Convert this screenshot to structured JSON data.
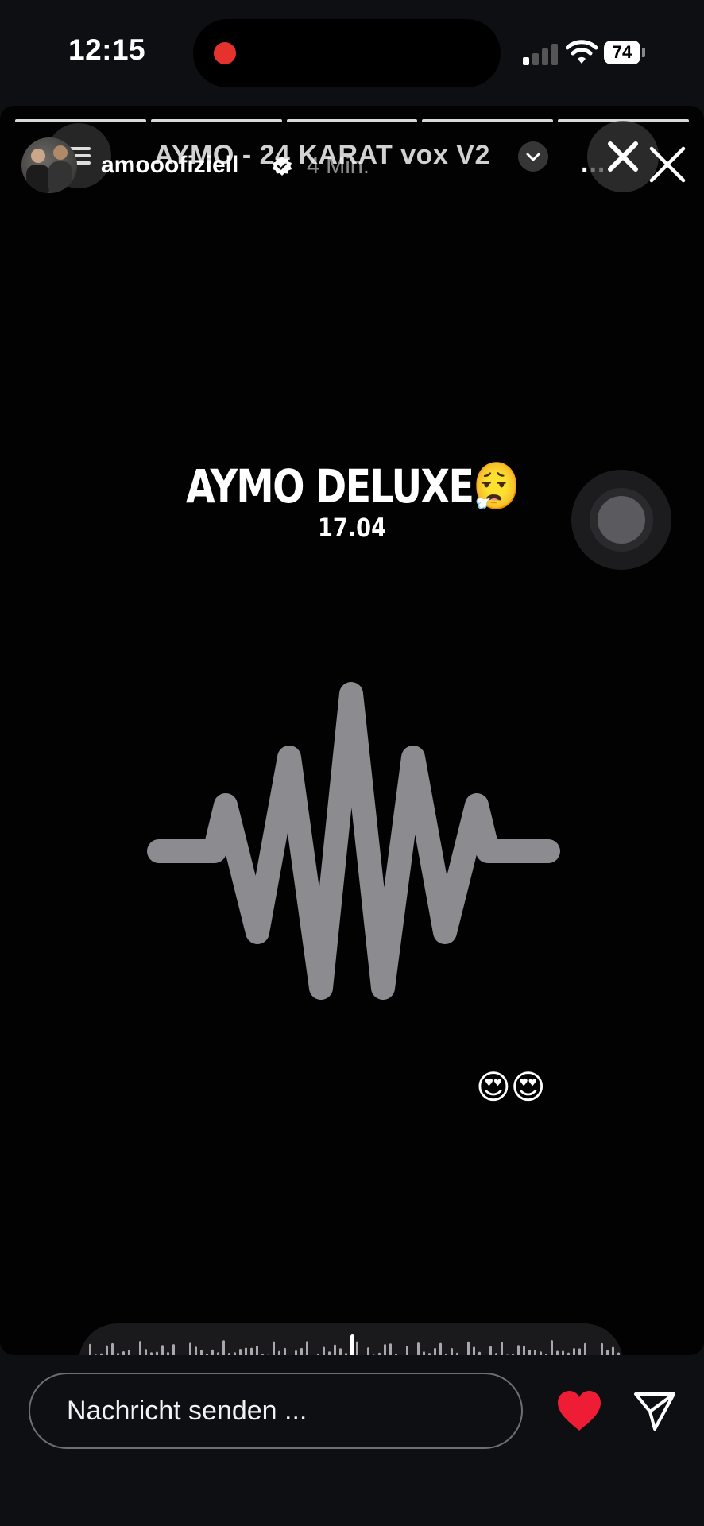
{
  "status_bar": {
    "time": "12:15",
    "battery": "74",
    "recording_color": "#e5322d",
    "signal_bars_active": 1,
    "signal_bars_total": 4
  },
  "story": {
    "segments": 5,
    "username": "amooofiziell",
    "verified": true,
    "time_ago": "4 Min.",
    "song_title": "AYMO - 24 KARAT vox V2",
    "more_label": "...",
    "headline": "AYMO DELUXE😮‍💨",
    "date": "17.04",
    "emojis": "😍😍",
    "icons": [
      "menu-icon",
      "verified-icon",
      "chevron-down-icon",
      "close-icon",
      "heart-icon",
      "send-icon"
    ]
  },
  "composer": {
    "placeholder": "Nachricht senden ...",
    "heart_color": "#ee1d35"
  }
}
